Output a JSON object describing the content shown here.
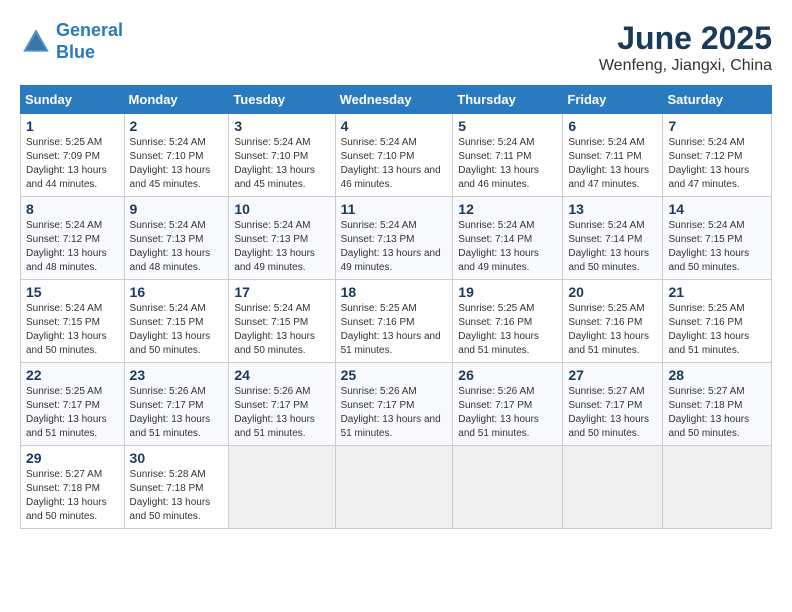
{
  "logo": {
    "line1": "General",
    "line2": "Blue"
  },
  "title": "June 2025",
  "subtitle": "Wenfeng, Jiangxi, China",
  "headers": [
    "Sunday",
    "Monday",
    "Tuesday",
    "Wednesday",
    "Thursday",
    "Friday",
    "Saturday"
  ],
  "weeks": [
    [
      {
        "num": "1",
        "sunrise": "5:25 AM",
        "sunset": "7:09 PM",
        "daylight": "13 hours and 44 minutes."
      },
      {
        "num": "2",
        "sunrise": "5:24 AM",
        "sunset": "7:10 PM",
        "daylight": "13 hours and 45 minutes."
      },
      {
        "num": "3",
        "sunrise": "5:24 AM",
        "sunset": "7:10 PM",
        "daylight": "13 hours and 45 minutes."
      },
      {
        "num": "4",
        "sunrise": "5:24 AM",
        "sunset": "7:10 PM",
        "daylight": "13 hours and 46 minutes."
      },
      {
        "num": "5",
        "sunrise": "5:24 AM",
        "sunset": "7:11 PM",
        "daylight": "13 hours and 46 minutes."
      },
      {
        "num": "6",
        "sunrise": "5:24 AM",
        "sunset": "7:11 PM",
        "daylight": "13 hours and 47 minutes."
      },
      {
        "num": "7",
        "sunrise": "5:24 AM",
        "sunset": "7:12 PM",
        "daylight": "13 hours and 47 minutes."
      }
    ],
    [
      {
        "num": "8",
        "sunrise": "5:24 AM",
        "sunset": "7:12 PM",
        "daylight": "13 hours and 48 minutes."
      },
      {
        "num": "9",
        "sunrise": "5:24 AM",
        "sunset": "7:13 PM",
        "daylight": "13 hours and 48 minutes."
      },
      {
        "num": "10",
        "sunrise": "5:24 AM",
        "sunset": "7:13 PM",
        "daylight": "13 hours and 49 minutes."
      },
      {
        "num": "11",
        "sunrise": "5:24 AM",
        "sunset": "7:13 PM",
        "daylight": "13 hours and 49 minutes."
      },
      {
        "num": "12",
        "sunrise": "5:24 AM",
        "sunset": "7:14 PM",
        "daylight": "13 hours and 49 minutes."
      },
      {
        "num": "13",
        "sunrise": "5:24 AM",
        "sunset": "7:14 PM",
        "daylight": "13 hours and 50 minutes."
      },
      {
        "num": "14",
        "sunrise": "5:24 AM",
        "sunset": "7:15 PM",
        "daylight": "13 hours and 50 minutes."
      }
    ],
    [
      {
        "num": "15",
        "sunrise": "5:24 AM",
        "sunset": "7:15 PM",
        "daylight": "13 hours and 50 minutes."
      },
      {
        "num": "16",
        "sunrise": "5:24 AM",
        "sunset": "7:15 PM",
        "daylight": "13 hours and 50 minutes."
      },
      {
        "num": "17",
        "sunrise": "5:24 AM",
        "sunset": "7:15 PM",
        "daylight": "13 hours and 50 minutes."
      },
      {
        "num": "18",
        "sunrise": "5:25 AM",
        "sunset": "7:16 PM",
        "daylight": "13 hours and 51 minutes."
      },
      {
        "num": "19",
        "sunrise": "5:25 AM",
        "sunset": "7:16 PM",
        "daylight": "13 hours and 51 minutes."
      },
      {
        "num": "20",
        "sunrise": "5:25 AM",
        "sunset": "7:16 PM",
        "daylight": "13 hours and 51 minutes."
      },
      {
        "num": "21",
        "sunrise": "5:25 AM",
        "sunset": "7:16 PM",
        "daylight": "13 hours and 51 minutes."
      }
    ],
    [
      {
        "num": "22",
        "sunrise": "5:25 AM",
        "sunset": "7:17 PM",
        "daylight": "13 hours and 51 minutes."
      },
      {
        "num": "23",
        "sunrise": "5:26 AM",
        "sunset": "7:17 PM",
        "daylight": "13 hours and 51 minutes."
      },
      {
        "num": "24",
        "sunrise": "5:26 AM",
        "sunset": "7:17 PM",
        "daylight": "13 hours and 51 minutes."
      },
      {
        "num": "25",
        "sunrise": "5:26 AM",
        "sunset": "7:17 PM",
        "daylight": "13 hours and 51 minutes."
      },
      {
        "num": "26",
        "sunrise": "5:26 AM",
        "sunset": "7:17 PM",
        "daylight": "13 hours and 51 minutes."
      },
      {
        "num": "27",
        "sunrise": "5:27 AM",
        "sunset": "7:17 PM",
        "daylight": "13 hours and 50 minutes."
      },
      {
        "num": "28",
        "sunrise": "5:27 AM",
        "sunset": "7:18 PM",
        "daylight": "13 hours and 50 minutes."
      }
    ],
    [
      {
        "num": "29",
        "sunrise": "5:27 AM",
        "sunset": "7:18 PM",
        "daylight": "13 hours and 50 minutes."
      },
      {
        "num": "30",
        "sunrise": "5:28 AM",
        "sunset": "7:18 PM",
        "daylight": "13 hours and 50 minutes."
      },
      null,
      null,
      null,
      null,
      null
    ]
  ]
}
